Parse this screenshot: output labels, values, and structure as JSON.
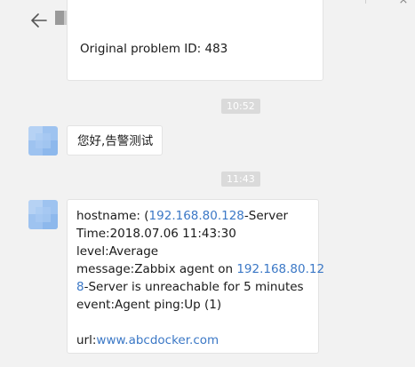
{
  "header": {
    "title_redacted": true,
    "back_icon": "arrow-left-icon",
    "close_icon": "close-icon"
  },
  "messages": [
    {
      "type": "text",
      "text": "Original problem ID: 483"
    },
    {
      "type": "timestamp",
      "text": "10:52"
    },
    {
      "type": "text",
      "text": "您好,告警测试"
    },
    {
      "type": "timestamp",
      "text": "11:43"
    },
    {
      "type": "alert",
      "hostname_prefix": "hostname: (",
      "hostname_ip": "192.168.80.128",
      "hostname_suffix": "-Server",
      "time_line": "Time:2018.07.06 11:43:30",
      "level_line": "level:Average",
      "message_prefix": "message:Zabbix agent on ",
      "message_ip_part1": "192.168.80.12",
      "message_ip_part2": "8",
      "message_suffix_line1": "",
      "message_line2_rest": "-Server is unreachable for 5 minutes",
      "event_line": "event:Agent ping:Up (1)",
      "url_prefix": "url:",
      "url_link": "www.abcdocker.com"
    }
  ],
  "colors": {
    "background": "#f2f2f2",
    "bubble": "#ffffff",
    "link": "#3b78c6",
    "timestamp_bg": "#dadada",
    "avatar": "#9ec3f0"
  }
}
